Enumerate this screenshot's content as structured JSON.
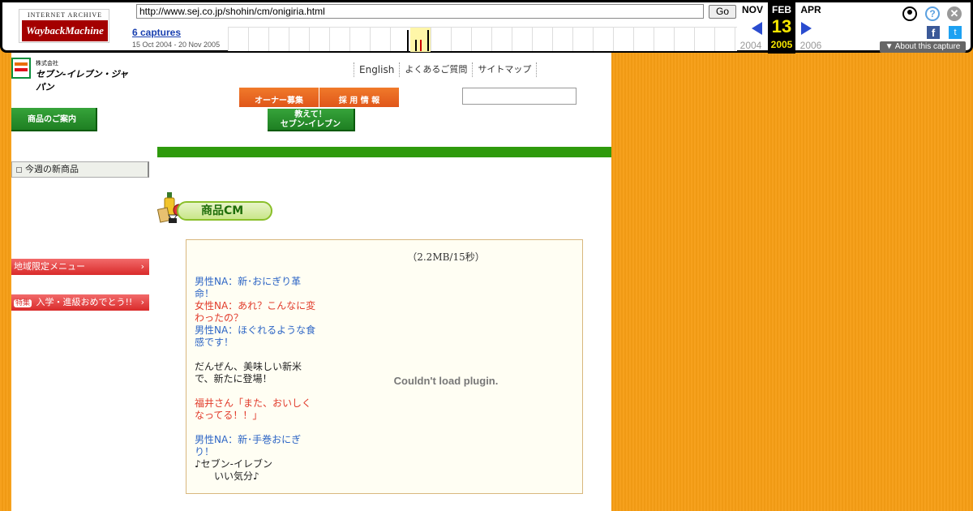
{
  "wayback": {
    "logo_top": "INTERNET ARCHIVE",
    "logo_main": "WaybackMachine",
    "url": "http://www.sej.co.jp/shohin/cm/onigiria.html",
    "go_label": "Go",
    "captures_link": "6 captures",
    "captures_range": "15 Oct 2004 - 20 Nov 2005",
    "prev_month": "NOV",
    "current_month": "FEB",
    "next_month": "APR",
    "current_day": "13",
    "prev_year": "2004",
    "current_year": "2005",
    "next_year": "2006",
    "about_label": "▼ About this capture",
    "help_glyph": "?",
    "close_glyph": "✕",
    "fb_glyph": "f",
    "tw_glyph": "t"
  },
  "header": {
    "logo_sub": "株式会社",
    "logo_name": "セブン-イレブン・ジャパン",
    "util_links": [
      "English",
      "よくあるご質問",
      "サイトマップ"
    ],
    "owner_button": "オーナー募集",
    "recruit_button": "採 用 情 報",
    "teach_button_line1": "教えて！",
    "teach_button_line2": "セブン-イレブン",
    "products_button": "商品のご案内"
  },
  "sidebar": {
    "new_items": "今週の新商品",
    "regional_menu": "地域限定メニュー",
    "feature_tag": "特集",
    "feature_label": "入学・進級おめでとう!!",
    "chevron": "›"
  },
  "main": {
    "section_title": "商品CM",
    "file_info": "（2.2MB/15秒）",
    "plugin_message": "Couldn't load plugin.",
    "script": [
      {
        "color": "blue",
        "text": "男性NA：新･おにぎり革命！"
      },
      {
        "color": "red",
        "text": "女性NA：あれ？こんなに変わったの？"
      },
      {
        "color": "blue",
        "text": "男性NA：ほぐれるような食感です！",
        "gap": true
      },
      {
        "color": "dark",
        "text": "だんぜん、美味しい新米で、新たに登場！",
        "gap": true
      },
      {
        "color": "red",
        "text": "福井さん「また、おいしくなってる！！」",
        "gap": true
      },
      {
        "color": "blue",
        "text": "男性NA：新･手巻おにぎり！"
      },
      {
        "color": "dark",
        "text": "♪セブン-イレブン"
      },
      {
        "color": "dark",
        "text": "　　いい気分♪"
      }
    ]
  }
}
